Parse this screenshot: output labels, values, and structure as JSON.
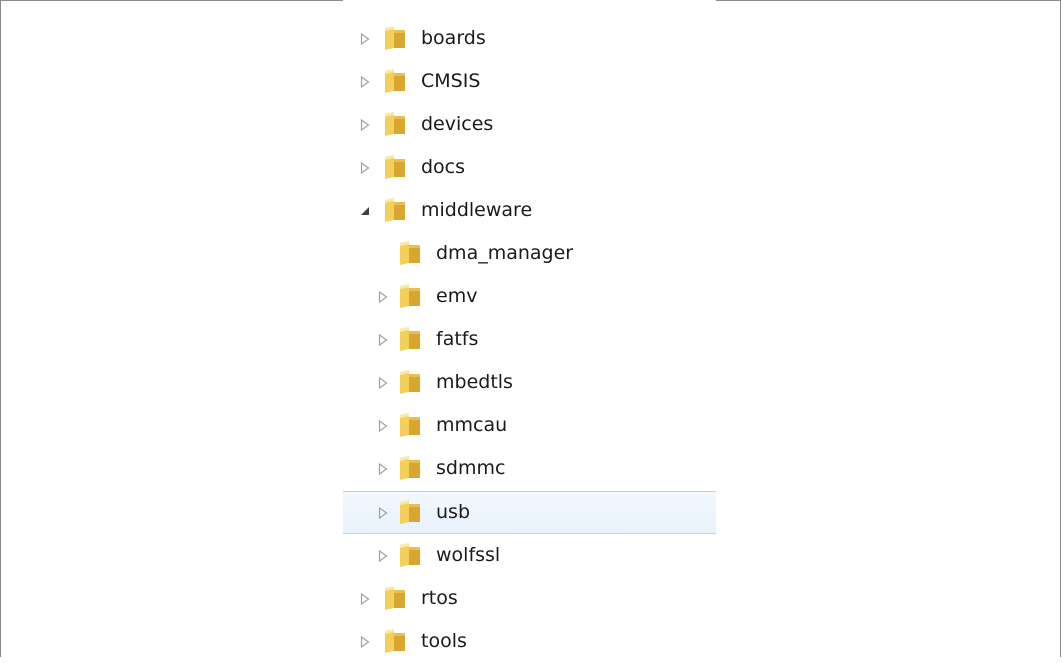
{
  "tree": {
    "items": [
      {
        "label": "boards",
        "level": 0,
        "state": "collapsed",
        "icon": "folder-icon"
      },
      {
        "label": "CMSIS",
        "level": 0,
        "state": "collapsed",
        "icon": "folder-icon"
      },
      {
        "label": "devices",
        "level": 0,
        "state": "collapsed",
        "icon": "folder-icon"
      },
      {
        "label": "docs",
        "level": 0,
        "state": "collapsed",
        "icon": "folder-icon"
      },
      {
        "label": "middleware",
        "level": 0,
        "state": "expanded",
        "icon": "folder-icon"
      },
      {
        "label": "dma_manager",
        "level": 1,
        "state": "leaf",
        "icon": "folder-icon"
      },
      {
        "label": "emv",
        "level": 1,
        "state": "collapsed",
        "icon": "folder-icon"
      },
      {
        "label": "fatfs",
        "level": 1,
        "state": "collapsed",
        "icon": "folder-icon"
      },
      {
        "label": "mbedtls",
        "level": 1,
        "state": "collapsed",
        "icon": "folder-icon"
      },
      {
        "label": "mmcau",
        "level": 1,
        "state": "collapsed",
        "icon": "folder-icon"
      },
      {
        "label": "sdmmc",
        "level": 1,
        "state": "collapsed",
        "icon": "folder-icon"
      },
      {
        "label": "usb",
        "level": 1,
        "state": "collapsed",
        "icon": "folder-icon",
        "selected": true
      },
      {
        "label": "wolfssl",
        "level": 1,
        "state": "collapsed",
        "icon": "folder-icon"
      },
      {
        "label": "rtos",
        "level": 0,
        "state": "collapsed",
        "icon": "folder-icon"
      },
      {
        "label": "tools",
        "level": 0,
        "state": "collapsed",
        "icon": "folder-icon"
      }
    ]
  },
  "colors": {
    "selection_background": "#e8f2fc",
    "selection_border": "#b7d4ef",
    "folder_light": "#f8dc7a",
    "folder_dark": "#d9a630",
    "expander_outline": "#a0a0a0",
    "expander_filled": "#404040"
  }
}
